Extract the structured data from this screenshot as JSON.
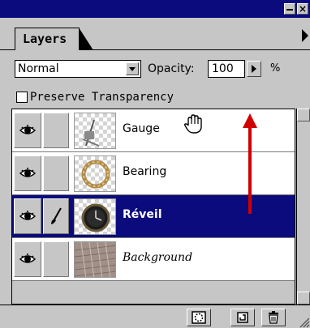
{
  "panel": {
    "tab_label": "Layers",
    "blend_mode": "Normal",
    "opacity_label": "Opacity:",
    "opacity_value": "100",
    "percent_sign": "%",
    "preserve_label": "Preserve Transparency",
    "preserve_checked": false
  },
  "layers": [
    {
      "name": "Gauge",
      "visible": true,
      "active": false,
      "thumbnail": "gauge-thumbnail"
    },
    {
      "name": "Bearing",
      "visible": true,
      "active": false,
      "thumbnail": "bearing-thumbnail"
    },
    {
      "name": "Réveil",
      "visible": true,
      "active": true,
      "thumbnail": "clock-thumbnail"
    },
    {
      "name": "Background",
      "visible": true,
      "active": false,
      "thumbnail": "keyboard-thumbnail"
    }
  ],
  "icons": {
    "eye": "eye-icon",
    "brush": "paintbrush-icon",
    "hand": "hand-cursor-icon",
    "mask": "layer-mask-icon",
    "new_layer": "new-layer-icon",
    "trash": "trash-icon"
  },
  "colors": {
    "highlight": "#0b0b7d",
    "arrow": "#d10000",
    "panel_bg": "#c6c6c6"
  }
}
